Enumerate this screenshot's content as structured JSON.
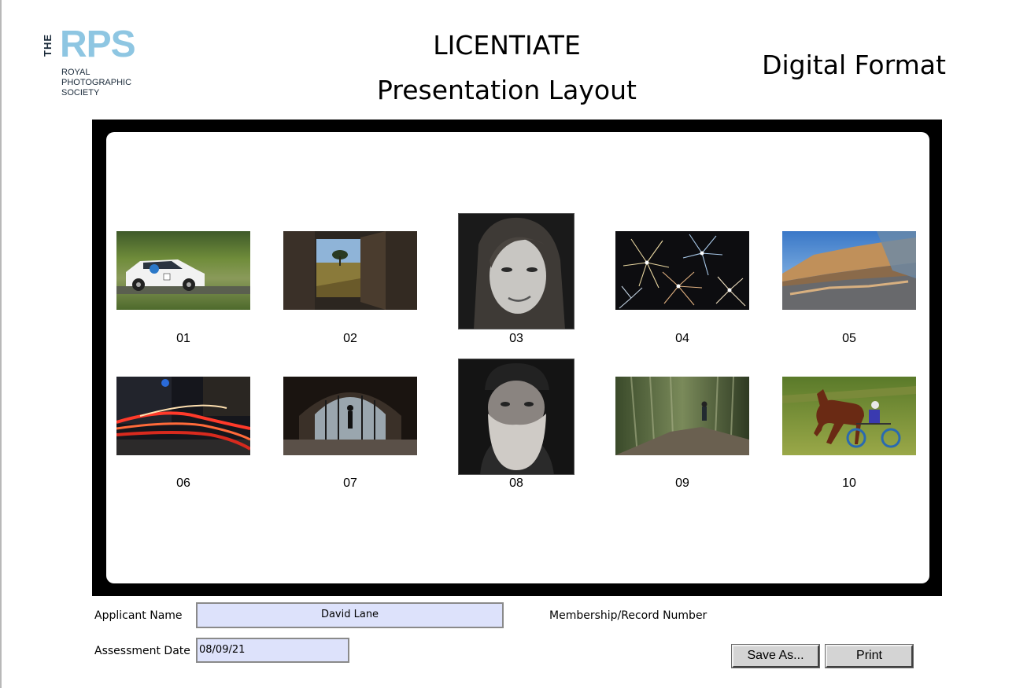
{
  "logo": {
    "prefix": "THE",
    "mark": "RPS",
    "line1": "ROYAL",
    "line2": "PHOTOGRAPHIC",
    "line3": "SOCIETY"
  },
  "header": {
    "title_line1": "LICENTIATE",
    "title_line2": "Presentation Layout",
    "format": "Digital Format"
  },
  "images": [
    {
      "number": "01",
      "subject": "rally car"
    },
    {
      "number": "02",
      "subject": "window view of tree"
    },
    {
      "number": "03",
      "subject": "portrait of woman (mono)"
    },
    {
      "number": "04",
      "subject": "fireworks"
    },
    {
      "number": "05",
      "subject": "building reflections"
    },
    {
      "number": "06",
      "subject": "light trails"
    },
    {
      "number": "07",
      "subject": "tunnel with figure"
    },
    {
      "number": "08",
      "subject": "bearded man portrait (mono)"
    },
    {
      "number": "09",
      "subject": "motion blur walker"
    },
    {
      "number": "10",
      "subject": "harness racing horse"
    }
  ],
  "form": {
    "applicant_label": "Applicant Name",
    "applicant_value": "David Lane",
    "membership_label": "Membership/Record Number",
    "date_label": "Assessment Date",
    "date_value": "08/09/21",
    "save_label": "Save As...",
    "print_label": "Print"
  },
  "colors": {
    "brand": "#8ec6e2",
    "field_bg": "#dde2fb",
    "button_bg": "#d4d4d4"
  }
}
